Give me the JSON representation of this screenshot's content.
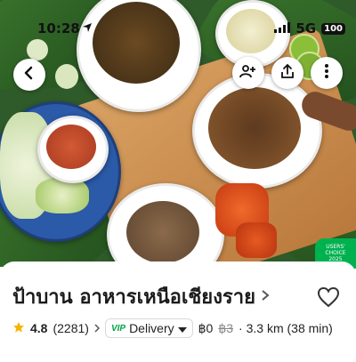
{
  "status": {
    "time": "10:28",
    "network": "5G",
    "battery": "100"
  },
  "hero": {
    "badge": {
      "line1": "USERS'",
      "line2": "CHOICE",
      "line3": "2025"
    },
    "colors": {
      "leaf": "#3e7a2f",
      "board": "#c98a4b",
      "curry": "#8a5a2e",
      "sauce": "#c1502f"
    }
  },
  "restaurant": {
    "name": "ป้าบาน อาหารเหนือเชียงราย",
    "rating": "4.8",
    "reviews": "(2281)",
    "delivery_prefix": "VIP",
    "delivery_mode": "Delivery",
    "fee_current": "฿0",
    "fee_original": "฿3",
    "distance": "· 3.3 km (38 min)"
  },
  "icons": {
    "back": "back-arrow-icon",
    "group": "add-group-icon",
    "share": "share-icon",
    "more": "more-vertical-icon",
    "favorite": "heart-outline-icon",
    "star": "star-icon"
  },
  "accent": "#00b14f"
}
